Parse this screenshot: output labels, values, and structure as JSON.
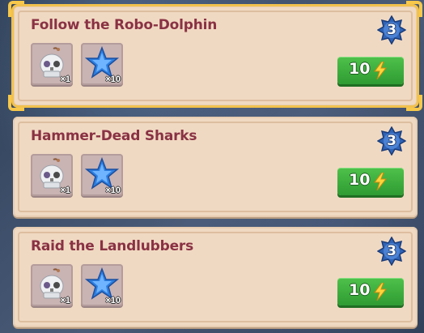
{
  "missions": [
    {
      "title": "Follow the Robo-Dolphin",
      "level": "3",
      "selected": true,
      "rewards": [
        {
          "icon": "robot-skull-icon",
          "qty": "×1"
        },
        {
          "icon": "blue-star-icon",
          "qty": "×10"
        }
      ],
      "cost": "10",
      "cost_icon": "lightning-bolt-icon"
    },
    {
      "title": "Hammer-Dead Sharks",
      "level": "3",
      "selected": false,
      "rewards": [
        {
          "icon": "robot-skull-icon",
          "qty": "×1"
        },
        {
          "icon": "blue-star-icon",
          "qty": "×10"
        }
      ],
      "cost": "10",
      "cost_icon": "lightning-bolt-icon"
    },
    {
      "title": "Raid the Landlubbers",
      "level": "3",
      "selected": false,
      "rewards": [
        {
          "icon": "robot-skull-icon",
          "qty": "×1"
        },
        {
          "icon": "blue-star-icon",
          "qty": "×10"
        }
      ],
      "cost": "10",
      "cost_icon": "lightning-bolt-icon"
    }
  ],
  "colors": {
    "title": "#8a3244",
    "card": "#f0d9c2",
    "button": "#3fae3e",
    "badge": "#2f63b5",
    "highlight": "#f7c84a"
  }
}
